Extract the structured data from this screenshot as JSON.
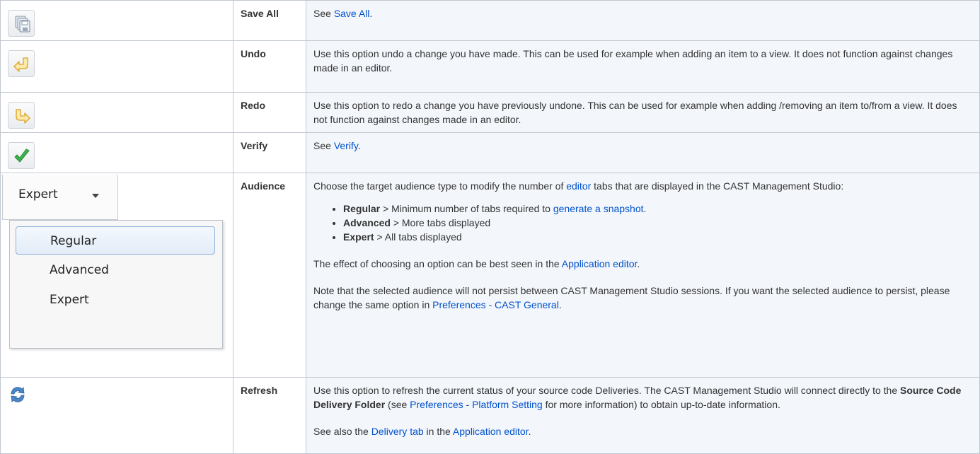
{
  "rows": {
    "save_all": {
      "icon": "save-all-icon",
      "name": "Save All",
      "desc_prefix": "See ",
      "link": "Save All",
      "desc_suffix": "."
    },
    "undo": {
      "icon": "undo-icon",
      "name": "Undo",
      "desc": "Use this option undo a change you have made. This can be used for example when adding an item to a view. It does not function against changes made in an editor."
    },
    "redo": {
      "icon": "redo-icon",
      "name": "Redo",
      "desc": "Use this option to redo a change you have previously undone. This can be used for example when adding /removing an item to/from a view. It does not function against changes made in an editor."
    },
    "verify": {
      "icon": "checkmark-icon",
      "name": "Verify",
      "desc_prefix": "See ",
      "link": "Verify",
      "desc_suffix": "."
    },
    "audience": {
      "name": "Audience",
      "combo_value": "Expert",
      "options": [
        "Regular",
        "Advanced",
        "Expert"
      ],
      "intro_a": "Choose the target audience type to modify the number of ",
      "intro_link": "editor",
      "intro_b": " tabs that are displayed in the CAST Management Studio:",
      "bullets": [
        {
          "term": "Regular",
          "text_a": " > Minimum number of tabs required to ",
          "link": "generate a snapshot",
          "text_b": "."
        },
        {
          "term": "Advanced",
          "text_a": " > More tabs displayed"
        },
        {
          "term": "Expert",
          "text_a": " > All tabs displayed"
        }
      ],
      "effect_a": "The effect of choosing an option can be best seen in the ",
      "effect_link": "Application editor",
      "effect_b": ".",
      "note_a": "Note that the selected audience will not persist between CAST Management Studio sessions. If you want the selected audience to persist, please change the same option in ",
      "note_link": "Preferences - CAST General",
      "note_b": "."
    },
    "refresh": {
      "icon": "refresh-icon",
      "name": "Refresh",
      "p1_a": "Use this option to refresh the current status of your source code Deliveries. The CAST Management Studio will connect directly to the ",
      "p1_bold": "Source Code Delivery Folder",
      "p1_b": " (see ",
      "p1_link": "Preferences - Platform Setting",
      "p1_c": " for more information) to obtain up-to-date information.",
      "p2_a": "See also the ",
      "p2_link1": "Delivery tab",
      "p2_b": " in the ",
      "p2_link2": "Application editor",
      "p2_c": "."
    }
  },
  "colors": {
    "link": "#0052cc",
    "desc_bg": "#f3f6fb",
    "border": "#c1c7d0",
    "check": "#3cb34a"
  }
}
